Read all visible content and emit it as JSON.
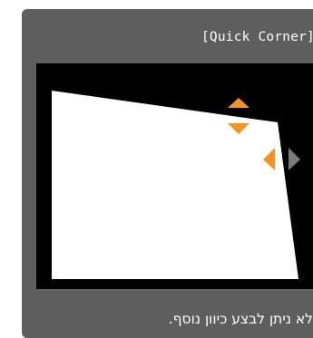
{
  "osd": {
    "title": "[Quick Corner]",
    "message": "לא ניתן לבצע כיוון נוסף."
  },
  "adjust_arrows": {
    "up": {
      "icon": "triangle-up-icon",
      "color": "#f7931e",
      "state": "enabled"
    },
    "down": {
      "icon": "triangle-down-icon",
      "color": "#f7931e",
      "state": "enabled"
    },
    "left": {
      "icon": "triangle-left-icon",
      "color": "#f7931e",
      "state": "enabled"
    },
    "right": {
      "icon": "triangle-right-icon",
      "color": "#7a7a7a",
      "state": "disabled"
    }
  },
  "colors": {
    "window_bg": "#5e5e5e",
    "preview_bg": "#000000",
    "image_fill": "#ffffff",
    "arrow_active": "#f7931e",
    "arrow_inactive": "#7a7a7a"
  }
}
